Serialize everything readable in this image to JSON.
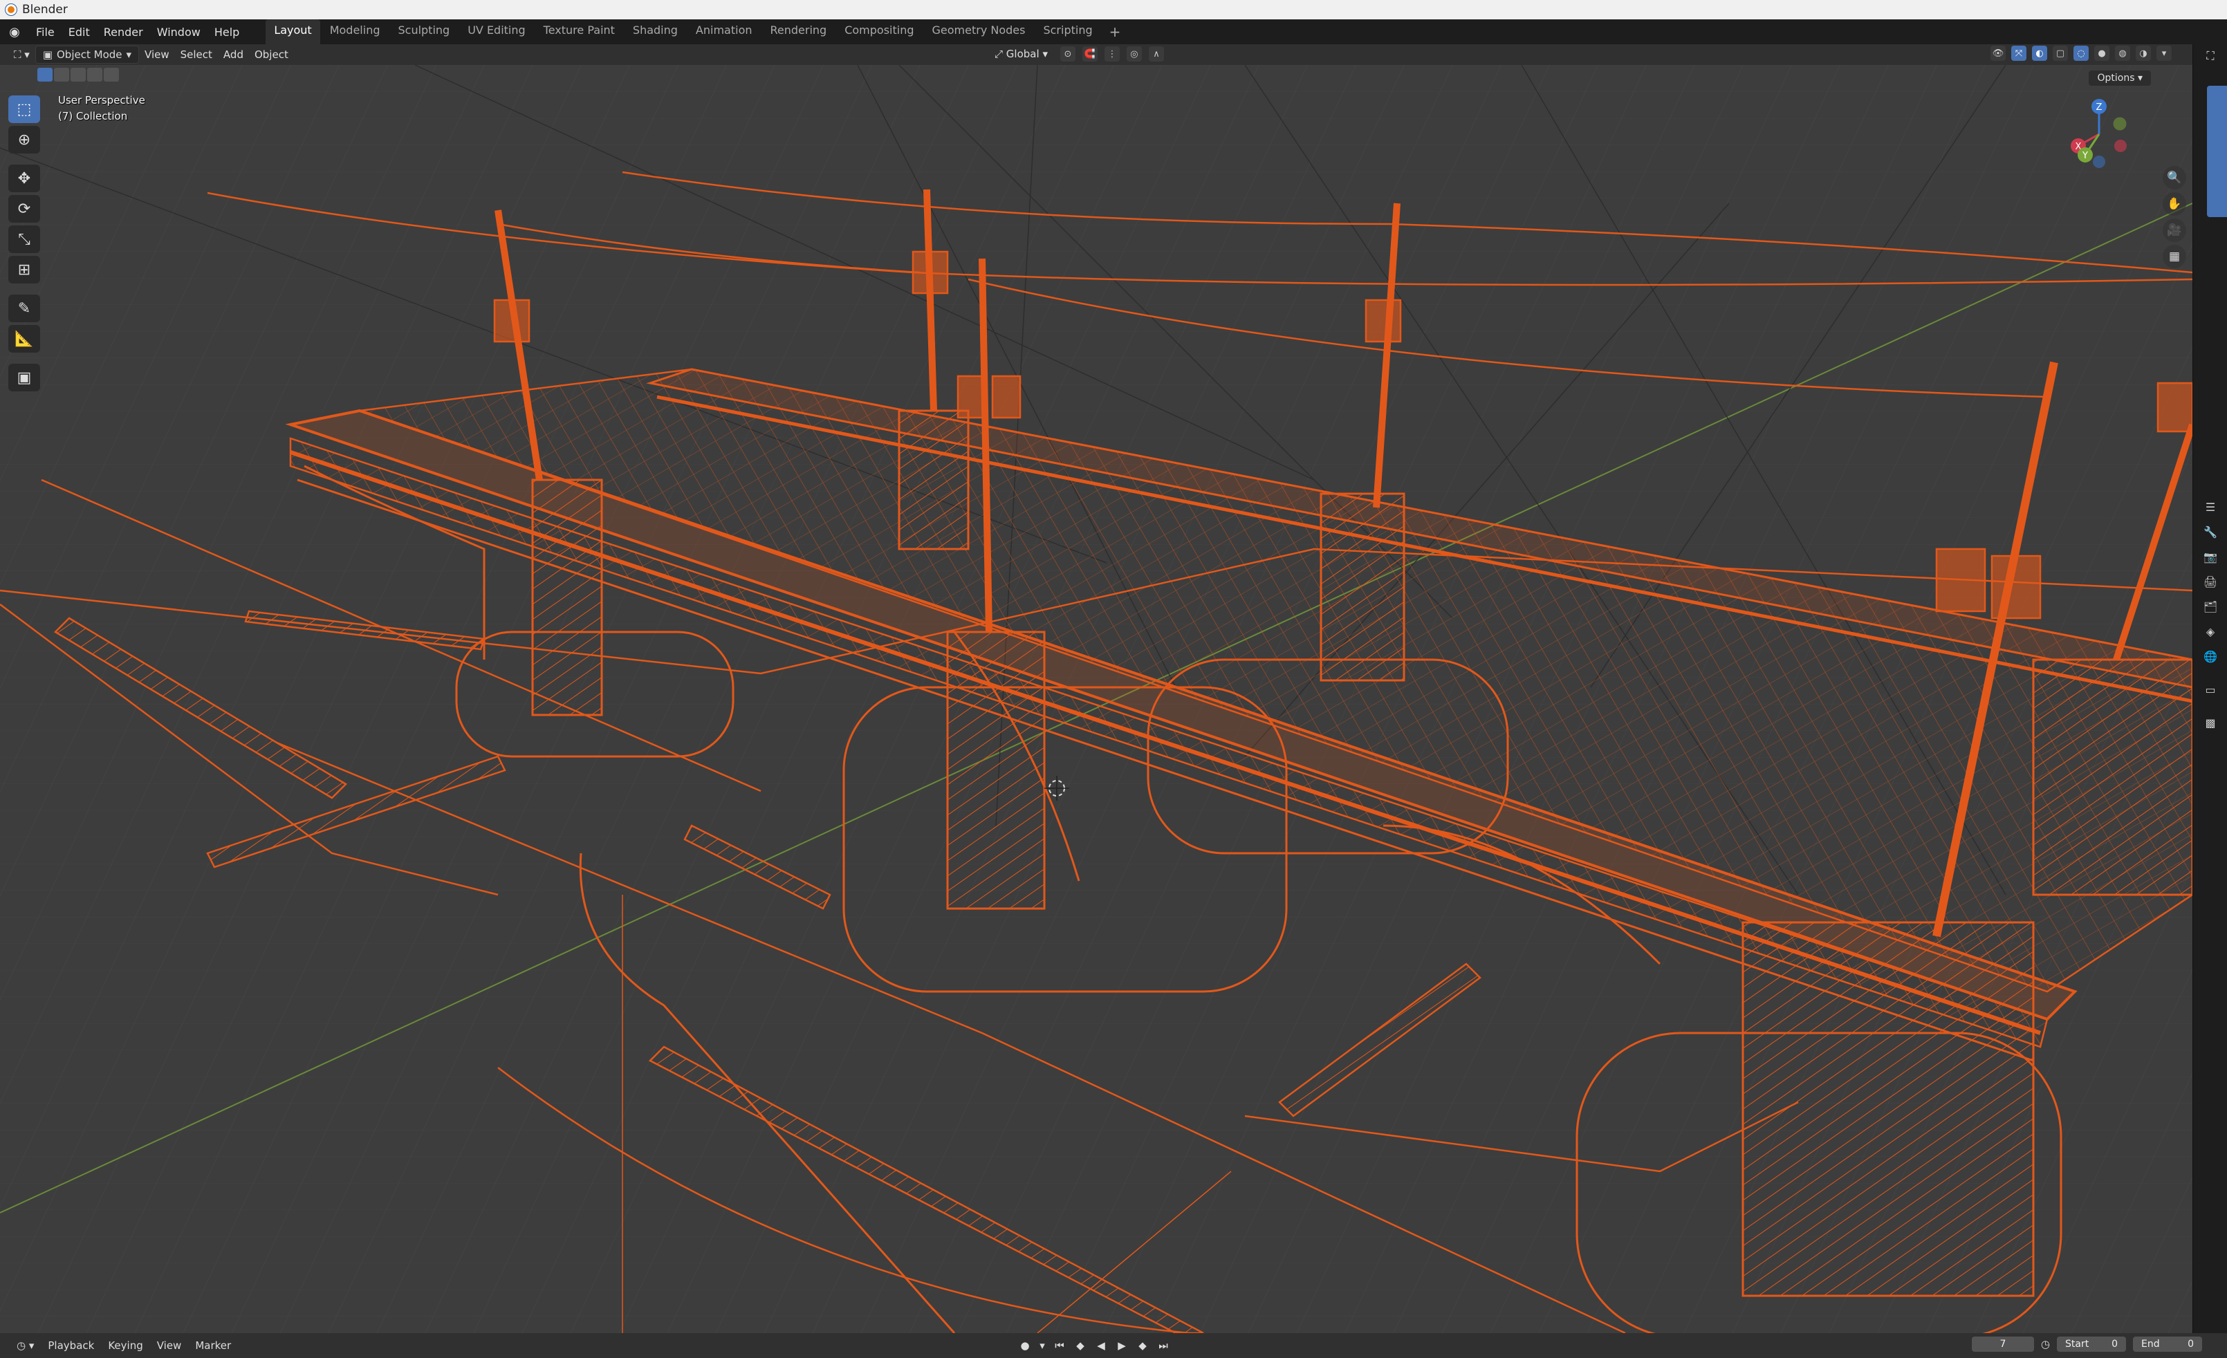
{
  "os_title": "Blender",
  "menu": [
    "File",
    "Edit",
    "Render",
    "Window",
    "Help"
  ],
  "workspaces": [
    "Layout",
    "Modeling",
    "Sculpting",
    "UV Editing",
    "Texture Paint",
    "Shading",
    "Animation",
    "Rendering",
    "Compositing",
    "Geometry Nodes",
    "Scripting"
  ],
  "active_workspace": "Layout",
  "viewport_header": {
    "mode": "Object Mode",
    "menus": [
      "View",
      "Select",
      "Add",
      "Object"
    ],
    "transform_orientation": "Global",
    "options_label": "Options"
  },
  "viewport_info": {
    "view_name": "User Perspective",
    "collection": "(7) Collection"
  },
  "tools": [
    "select-box",
    "cursor",
    "move",
    "rotate",
    "scale",
    "transform",
    "annotate",
    "measure",
    "add-cube"
  ],
  "gizmo_axes": {
    "x": "X",
    "y": "Y",
    "z": "Z"
  },
  "timeline": {
    "menus": [
      "Playback",
      "Keying",
      "View",
      "Marker"
    ],
    "current_frame": "7",
    "start_label": "Start",
    "start_value": "0",
    "end_label": "End",
    "end_value": "0"
  },
  "colors": {
    "wire": "#e2581a",
    "viewport_bg": "#3d3d3d",
    "accent": "#4772b3",
    "x_axis": "#cf3b4e",
    "y_axis": "#7aa83a",
    "z_axis": "#3b78cf"
  }
}
